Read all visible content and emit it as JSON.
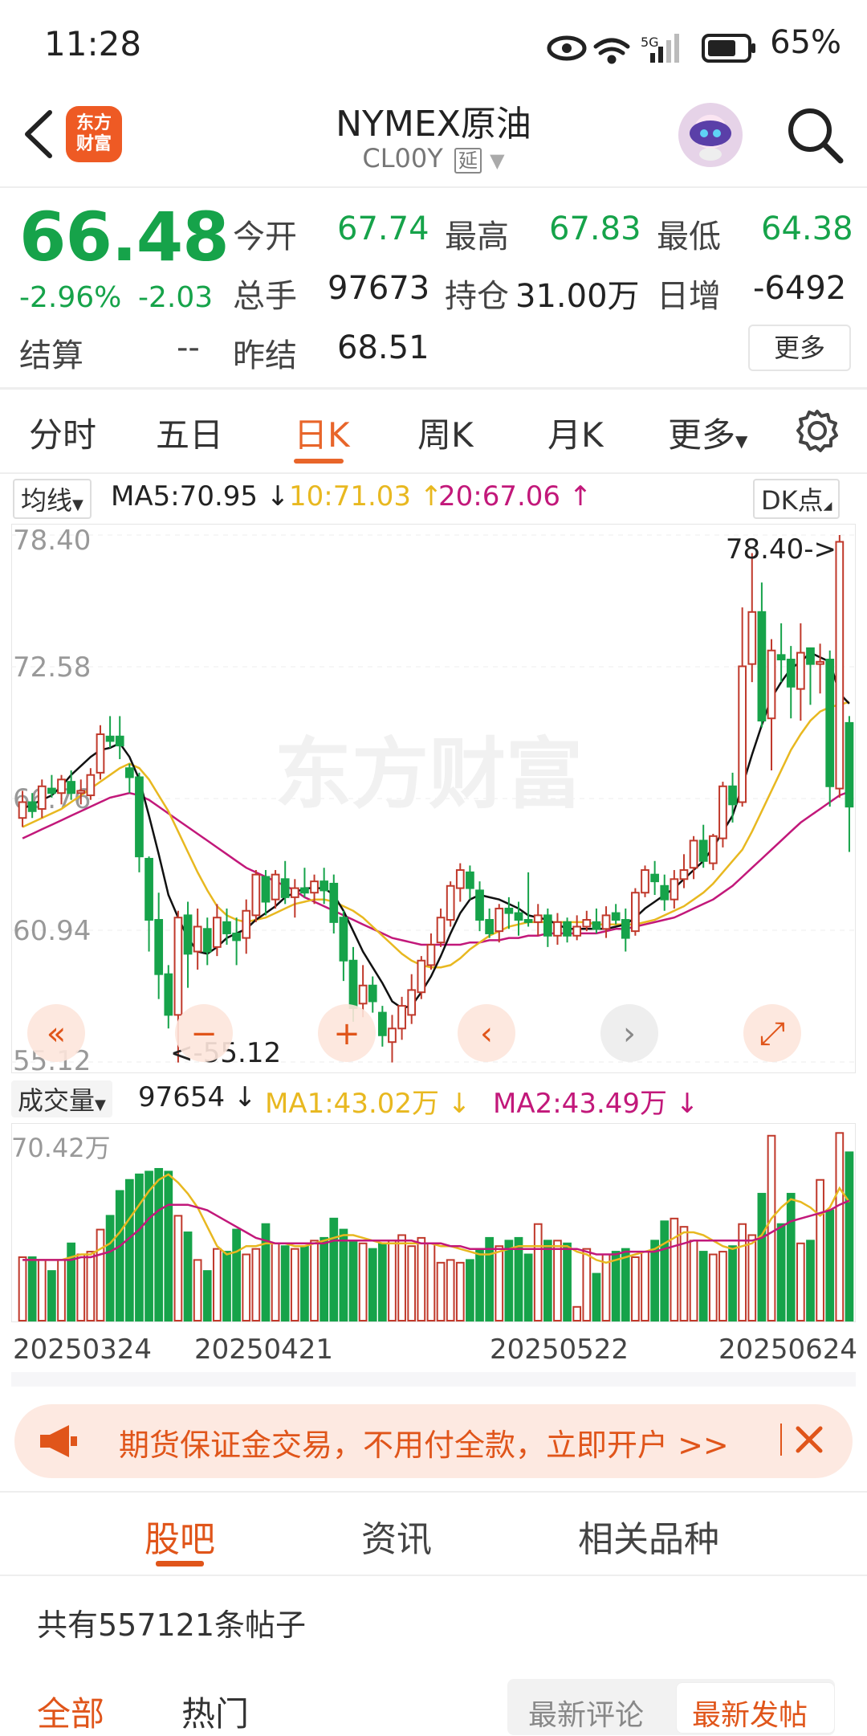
{
  "status_bar": {
    "time": "11:28",
    "battery": "65%"
  },
  "header": {
    "title": "NYMEX原油",
    "code": "CL00Y",
    "delay_tag": "延",
    "logo_text": "东方财富"
  },
  "quote": {
    "price": "66.48",
    "change_pct": "-2.96%",
    "change": "-2.03",
    "open_label": "今开",
    "open": "67.74",
    "high_label": "最高",
    "high": "67.83",
    "low_label": "最低",
    "low": "64.38",
    "volume_label": "总手",
    "volume": "97673",
    "oi_label": "持仓",
    "oi": "31.00万",
    "daily_inc_label": "日增",
    "daily_inc": "-6492",
    "settle_label": "结算",
    "settle": "--",
    "prev_settle_label": "昨结",
    "prev_settle": "68.51",
    "more_label": "更多"
  },
  "tabs": {
    "t1": "分时",
    "t2": "五日",
    "t3": "日K",
    "t4": "周K",
    "t5": "月K",
    "t6": "更多"
  },
  "indicator_row": {
    "ma_select": "均线",
    "ma5": "MA5:70.95 ↓",
    "ma10": "10:71.03 ↑",
    "ma20": "20:67.06 ↑",
    "dk_label": "DK点"
  },
  "volume_row": {
    "select": "成交量",
    "vol": "97654 ↓",
    "ma1": "MA1:43.02万 ↓",
    "ma2": "MA2:43.49万 ↓"
  },
  "chart_data": [
    {
      "type": "candlestick",
      "y_labels": [
        "78.40",
        "72.58",
        "66.76",
        "60.94",
        "55.12"
      ],
      "ylim": [
        55.12,
        78.4
      ],
      "max_annotation": "78.40->",
      "min_annotation": "<-55.12",
      "watermark": "东方财富",
      "colors": {
        "up": "#c0392b",
        "down": "#16a34a",
        "ma5": "#111111",
        "ma10": "#e8b820",
        "ma20": "#c2187a"
      },
      "candles": [
        [
          65.9,
          66.6,
          67.1,
          65.5
        ],
        [
          66.6,
          66.2,
          67.0,
          65.9
        ],
        [
          66.3,
          67.3,
          67.6,
          65.9
        ],
        [
          67.2,
          67.0,
          67.8,
          66.8
        ],
        [
          67.0,
          67.6,
          67.8,
          66.5
        ],
        [
          67.5,
          67.0,
          68.0,
          66.7
        ],
        [
          67.0,
          67.1,
          67.6,
          66.5
        ],
        [
          66.9,
          67.8,
          68.1,
          66.7
        ],
        [
          67.9,
          69.6,
          70.0,
          67.6
        ],
        [
          69.5,
          69.3,
          70.4,
          69.0
        ],
        [
          69.5,
          69.1,
          70.4,
          68.5
        ],
        [
          68.1,
          67.7,
          68.3,
          67.0
        ],
        [
          67.7,
          64.2,
          67.9,
          63.5
        ],
        [
          64.1,
          61.4,
          64.2,
          60.0
        ],
        [
          61.4,
          59.0,
          62.6,
          57.9
        ],
        [
          59.0,
          57.2,
          59.4,
          56.6
        ],
        [
          57.2,
          61.5,
          61.8,
          55.1
        ],
        [
          61.6,
          59.9,
          62.2,
          58.4
        ],
        [
          60.0,
          61.1,
          61.9,
          59.2
        ],
        [
          61.0,
          60.0,
          61.5,
          59.4
        ],
        [
          60.2,
          61.5,
          62.1,
          59.8
        ],
        [
          61.3,
          60.8,
          61.9,
          60.3
        ],
        [
          60.8,
          60.5,
          61.5,
          59.4
        ],
        [
          60.6,
          61.8,
          62.3,
          59.9
        ],
        [
          61.6,
          63.4,
          63.6,
          61.3
        ],
        [
          63.3,
          62.2,
          63.6,
          61.6
        ],
        [
          62.3,
          63.4,
          63.6,
          61.9
        ],
        [
          63.2,
          62.4,
          64.0,
          62.1
        ],
        [
          62.4,
          62.8,
          63.2,
          61.5
        ],
        [
          62.8,
          62.6,
          63.7,
          62.4
        ],
        [
          62.6,
          63.1,
          63.4,
          62.1
        ],
        [
          63.1,
          62.7,
          63.7,
          62.1
        ],
        [
          63.0,
          61.3,
          63.4,
          60.8
        ],
        [
          61.5,
          59.6,
          61.8,
          58.7
        ],
        [
          59.6,
          57.5,
          60.2,
          56.9
        ],
        [
          57.7,
          58.5,
          59.4,
          57.1
        ],
        [
          58.5,
          57.8,
          58.9,
          57.3
        ],
        [
          57.3,
          56.3,
          57.6,
          55.8
        ],
        [
          56.0,
          56.6,
          57.2,
          55.1
        ],
        [
          56.6,
          57.6,
          58.0,
          56.1
        ],
        [
          57.2,
          58.3,
          59.0,
          56.8
        ],
        [
          58.2,
          59.6,
          59.8,
          57.9
        ],
        [
          59.4,
          60.3,
          60.8,
          59.2
        ],
        [
          60.4,
          61.5,
          61.9,
          60.2
        ],
        [
          61.4,
          62.9,
          63.1,
          61.1
        ],
        [
          62.8,
          63.6,
          63.9,
          62.2
        ],
        [
          63.5,
          62.8,
          63.8,
          62.3
        ],
        [
          62.7,
          61.4,
          63.1,
          60.9
        ],
        [
          61.4,
          60.8,
          61.9,
          60.6
        ],
        [
          60.9,
          61.9,
          62.1,
          60.4
        ],
        [
          61.9,
          61.7,
          62.4,
          61.0
        ],
        [
          61.7,
          61.4,
          62.2,
          60.7
        ],
        [
          61.4,
          61.3,
          63.5,
          61.1
        ],
        [
          61.3,
          61.6,
          62.1,
          60.7
        ],
        [
          61.6,
          60.7,
          61.9,
          60.2
        ],
        [
          60.7,
          61.3,
          61.7,
          60.3
        ],
        [
          61.3,
          60.7,
          61.5,
          60.4
        ],
        [
          60.7,
          61.1,
          61.6,
          60.5
        ],
        [
          61.1,
          61.4,
          61.8,
          60.9
        ],
        [
          61.3,
          61.0,
          61.9,
          60.8
        ],
        [
          61.0,
          61.6,
          62.0,
          60.6
        ],
        [
          61.7,
          61.4,
          62.1,
          61.2
        ],
        [
          61.4,
          60.6,
          61.9,
          60.0
        ],
        [
          60.9,
          62.6,
          62.8,
          60.7
        ],
        [
          62.6,
          63.6,
          63.8,
          62.4
        ],
        [
          63.4,
          63.1,
          64.0,
          62.5
        ],
        [
          62.9,
          62.3,
          63.4,
          61.8
        ],
        [
          62.3,
          63.2,
          63.6,
          61.9
        ],
        [
          63.2,
          63.6,
          64.3,
          62.8
        ],
        [
          63.7,
          64.9,
          65.1,
          63.2
        ],
        [
          64.9,
          64.0,
          65.6,
          63.7
        ],
        [
          63.9,
          65.1,
          65.2,
          63.6
        ],
        [
          65.0,
          67.3,
          67.5,
          64.6
        ],
        [
          67.3,
          66.5,
          67.9,
          65.7
        ],
        [
          66.6,
          72.6,
          75.2,
          66.4
        ],
        [
          72.7,
          75.0,
          77.6,
          71.9
        ],
        [
          75.0,
          70.2,
          76.3,
          69.9
        ],
        [
          70.3,
          73.3,
          73.8,
          68.0
        ],
        [
          73.1,
          72.9,
          74.5,
          71.9
        ],
        [
          72.9,
          71.7,
          73.5,
          70.3
        ],
        [
          71.6,
          73.2,
          74.5,
          70.2
        ],
        [
          73.4,
          72.7,
          73.4,
          70.9
        ],
        [
          72.7,
          72.8,
          73.6,
          71.4
        ],
        [
          72.9,
          67.3,
          73.3,
          66.4
        ],
        [
          67.2,
          78.1,
          78.4,
          66.8
        ],
        [
          70.1,
          66.4,
          70.4,
          64.4
        ]
      ],
      "ma5": [
        66.3,
        66.5,
        66.7,
        66.9,
        67.3,
        67.8,
        68.2,
        68.6,
        68.9,
        69.0,
        69.2,
        68.6,
        67.6,
        66.0,
        64.3,
        62.5,
        61.5,
        60.6,
        60.0,
        59.9,
        60.2,
        60.6,
        60.8,
        61.0,
        61.4,
        61.7,
        62.0,
        62.4,
        62.6,
        62.8,
        62.8,
        62.8,
        62.5,
        61.8,
        60.9,
        60.0,
        59.3,
        58.6,
        57.8,
        57.5,
        57.6,
        58.2,
        58.9,
        59.8,
        60.8,
        61.7,
        62.3,
        62.5,
        62.4,
        62.3,
        62.1,
        61.9,
        61.6,
        61.5,
        61.4,
        61.2,
        61.0,
        61.0,
        61.0,
        61.0,
        61.0,
        61.1,
        61.2,
        61.5,
        61.9,
        62.2,
        62.5,
        62.8,
        63.2,
        63.6,
        64.0,
        64.6,
        65.3,
        66.0,
        67.3,
        68.7,
        70.0,
        71.2,
        71.9,
        72.5,
        72.8,
        73.2,
        73.0,
        72.8,
        71.4,
        70.95
      ],
      "ma10": [
        65.5,
        65.7,
        65.9,
        66.1,
        66.3,
        66.6,
        66.9,
        67.2,
        67.5,
        67.8,
        68.1,
        68.3,
        68.1,
        67.6,
        66.9,
        66.2,
        65.3,
        64.4,
        63.5,
        62.7,
        62.0,
        61.6,
        61.4,
        61.3,
        61.4,
        61.5,
        61.7,
        61.9,
        62.1,
        62.2,
        62.3,
        62.3,
        62.2,
        62.0,
        61.8,
        61.5,
        61.1,
        60.7,
        60.3,
        59.9,
        59.6,
        59.4,
        59.3,
        59.3,
        59.4,
        59.7,
        60.1,
        60.4,
        60.7,
        60.9,
        61.1,
        61.2,
        61.3,
        61.3,
        61.3,
        61.3,
        61.3,
        61.3,
        61.3,
        61.2,
        61.2,
        61.2,
        61.2,
        61.2,
        61.3,
        61.4,
        61.6,
        61.8,
        62.0,
        62.3,
        62.6,
        63.0,
        63.5,
        64.0,
        64.5,
        65.3,
        66.2,
        67.1,
        68.0,
        68.9,
        69.6,
        70.2,
        70.6,
        70.8,
        70.9,
        71.03
      ],
      "ma20": [
        65.0,
        65.2,
        65.4,
        65.6,
        65.8,
        66.0,
        66.2,
        66.4,
        66.6,
        66.8,
        66.9,
        67.0,
        66.9,
        66.7,
        66.4,
        66.1,
        65.8,
        65.5,
        65.2,
        64.9,
        64.6,
        64.3,
        64.0,
        63.7,
        63.5,
        63.3,
        63.1,
        62.9,
        62.7,
        62.4,
        62.2,
        62.0,
        61.8,
        61.6,
        61.4,
        61.2,
        61.0,
        60.8,
        60.6,
        60.5,
        60.4,
        60.3,
        60.3,
        60.3,
        60.3,
        60.3,
        60.4,
        60.4,
        60.5,
        60.5,
        60.6,
        60.6,
        60.7,
        60.7,
        60.8,
        60.8,
        60.8,
        60.8,
        60.8,
        60.8,
        60.9,
        61.0,
        61.0,
        61.1,
        61.2,
        61.3,
        61.4,
        61.5,
        61.7,
        61.9,
        62.1,
        62.3,
        62.6,
        62.9,
        63.3,
        63.7,
        64.1,
        64.5,
        64.9,
        65.3,
        65.7,
        66.0,
        66.3,
        66.6,
        66.9,
        67.06
      ]
    },
    {
      "type": "bar",
      "y_labels": [
        "70.42万"
      ],
      "ylim": [
        0,
        70.42
      ],
      "x_labels": [
        "20250324",
        "20250421",
        "20250522",
        "20250624"
      ],
      "volume": [
        23,
        23,
        22,
        18,
        22,
        28,
        24,
        25,
        33,
        38,
        47,
        51,
        53,
        54,
        55,
        54,
        38,
        32,
        22,
        18,
        26,
        25,
        33,
        24,
        26,
        35,
        28,
        27,
        26,
        27,
        29,
        30,
        37,
        33,
        29,
        28,
        26,
        28,
        29,
        31,
        27,
        30,
        28,
        21,
        22,
        21,
        22,
        26,
        30,
        27,
        29,
        30,
        24,
        35,
        29,
        29,
        28,
        5,
        26,
        17,
        24,
        25,
        26,
        23,
        25,
        29,
        36,
        37,
        34,
        29,
        25,
        24,
        25,
        27,
        35,
        31,
        46,
        67,
        35,
        46,
        28,
        29,
        51,
        40,
        68,
        61
      ],
      "ma1": [
        22,
        22,
        22,
        22,
        22,
        23,
        24,
        24,
        26,
        28,
        32,
        37,
        42,
        47,
        51,
        53,
        50,
        46,
        41,
        34,
        27,
        24,
        25,
        27,
        27,
        28,
        28,
        28,
        27,
        27,
        28,
        29,
        30,
        31,
        31,
        30,
        29,
        28,
        28,
        28,
        28,
        28,
        28,
        27,
        27,
        26,
        25,
        24,
        24,
        25,
        26,
        27,
        27,
        27,
        27,
        27,
        27,
        25,
        24,
        22,
        21,
        22,
        23,
        24,
        25,
        26,
        28,
        30,
        32,
        32,
        31,
        29,
        27,
        26,
        27,
        28,
        31,
        37,
        41,
        44,
        43,
        41,
        38,
        41,
        48,
        43.02
      ],
      "ma2": [
        22,
        22,
        22,
        22,
        22,
        22,
        23,
        23,
        24,
        25,
        27,
        30,
        33,
        37,
        40,
        42,
        42,
        42,
        41,
        40,
        38,
        36,
        34,
        32,
        30,
        29,
        28,
        28,
        28,
        28,
        28,
        28,
        29,
        29,
        29,
        29,
        29,
        29,
        29,
        29,
        29,
        28,
        28,
        28,
        27,
        27,
        26,
        26,
        26,
        26,
        26,
        26,
        26,
        26,
        26,
        26,
        26,
        26,
        25,
        24,
        24,
        24,
        25,
        25,
        25,
        25,
        26,
        27,
        28,
        29,
        29,
        29,
        29,
        29,
        29,
        29,
        30,
        32,
        34,
        36,
        37,
        38,
        39,
        40,
        42,
        43.49
      ]
    }
  ],
  "chart_controls": [
    "«",
    "−",
    "+",
    "‹",
    "›",
    "⤢"
  ],
  "banner": {
    "text": "期货保证金交易，不用付全款，立即开户 >>"
  },
  "bottom_tabs": {
    "b1": "股吧",
    "b2": "资讯",
    "b3": "相关品种"
  },
  "posts": {
    "count_text": "共有557121条帖子"
  },
  "filter_tabs": {
    "f1": "全部",
    "f2": "热门",
    "f3": "最新评论",
    "f4": "最新发帖"
  }
}
